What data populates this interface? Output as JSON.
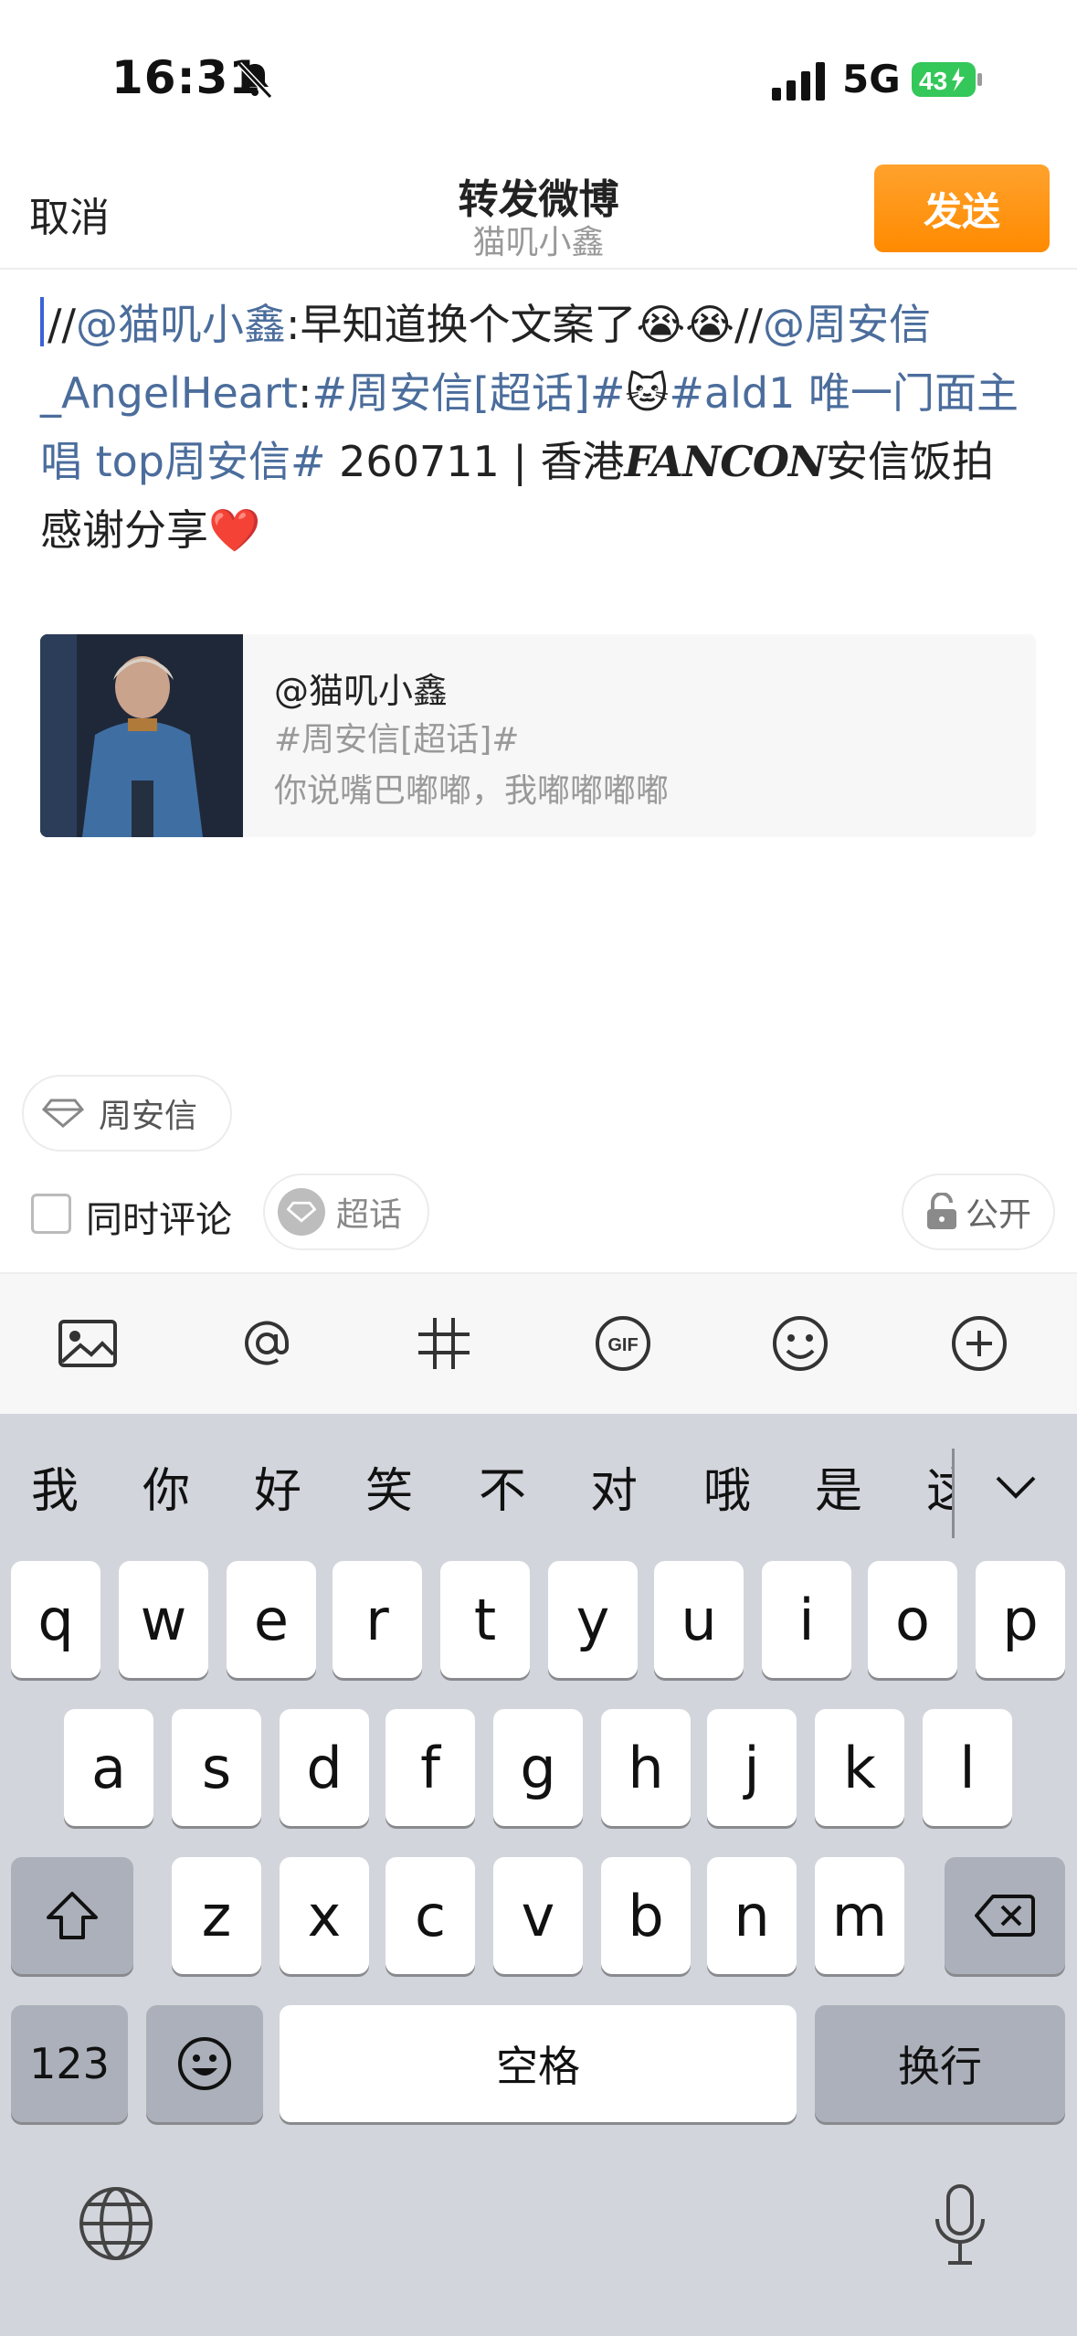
{
  "status_bar": {
    "time": "16:31",
    "network": "5G",
    "battery": "43"
  },
  "header": {
    "cancel_label": "取消",
    "title": "转发微博",
    "subtitle": "猫叽小鑫",
    "send_label": "发送",
    "accent_color": "#ff8a00"
  },
  "editor": {
    "seg1": "//",
    "seg2": "@猫叽小鑫",
    "seg3": ":早知道换个文案了",
    "emoji_cry": "😭😭",
    "seg4": "//",
    "seg5": "@周安信_AngelHeart",
    "seg6": ":",
    "seg7": "#周安信[超话]#",
    "emoji_cat": "🐱",
    "seg8": "#ald1 唯一门面主唱 top周安信#",
    "seg9": " 260711 | 香港",
    "seg10": "FANCON",
    "seg11": "安信饭拍 感谢分享",
    "emoji_heart": "❤️",
    "link_color": "#4b6d9c"
  },
  "quote": {
    "author": "@猫叽小鑫",
    "topic": "#周安信[超话]#",
    "body": "你说嘴巴嘟嘟，我嘟嘟嘟嘟"
  },
  "topic_chip": {
    "label": "周安信"
  },
  "options": {
    "comment_label": "同时评论",
    "chaohua_label": "超话",
    "public_label": "公开"
  },
  "toolbar": {
    "icons": [
      "image-icon",
      "at-icon",
      "hashtag-icon",
      "gif-icon",
      "emoji-icon",
      "add-icon"
    ]
  },
  "keyboard": {
    "candidates": [
      "我",
      "你",
      "好",
      "笑",
      "不",
      "对",
      "哦",
      "是",
      "这"
    ],
    "row1": [
      "q",
      "w",
      "e",
      "r",
      "t",
      "y",
      "u",
      "i",
      "o",
      "p"
    ],
    "row2": [
      "a",
      "s",
      "d",
      "f",
      "g",
      "h",
      "j",
      "k",
      "l"
    ],
    "row3": [
      "z",
      "x",
      "c",
      "v",
      "b",
      "n",
      "m"
    ],
    "num_label": "123",
    "space_label": "空格",
    "return_label": "换行"
  }
}
